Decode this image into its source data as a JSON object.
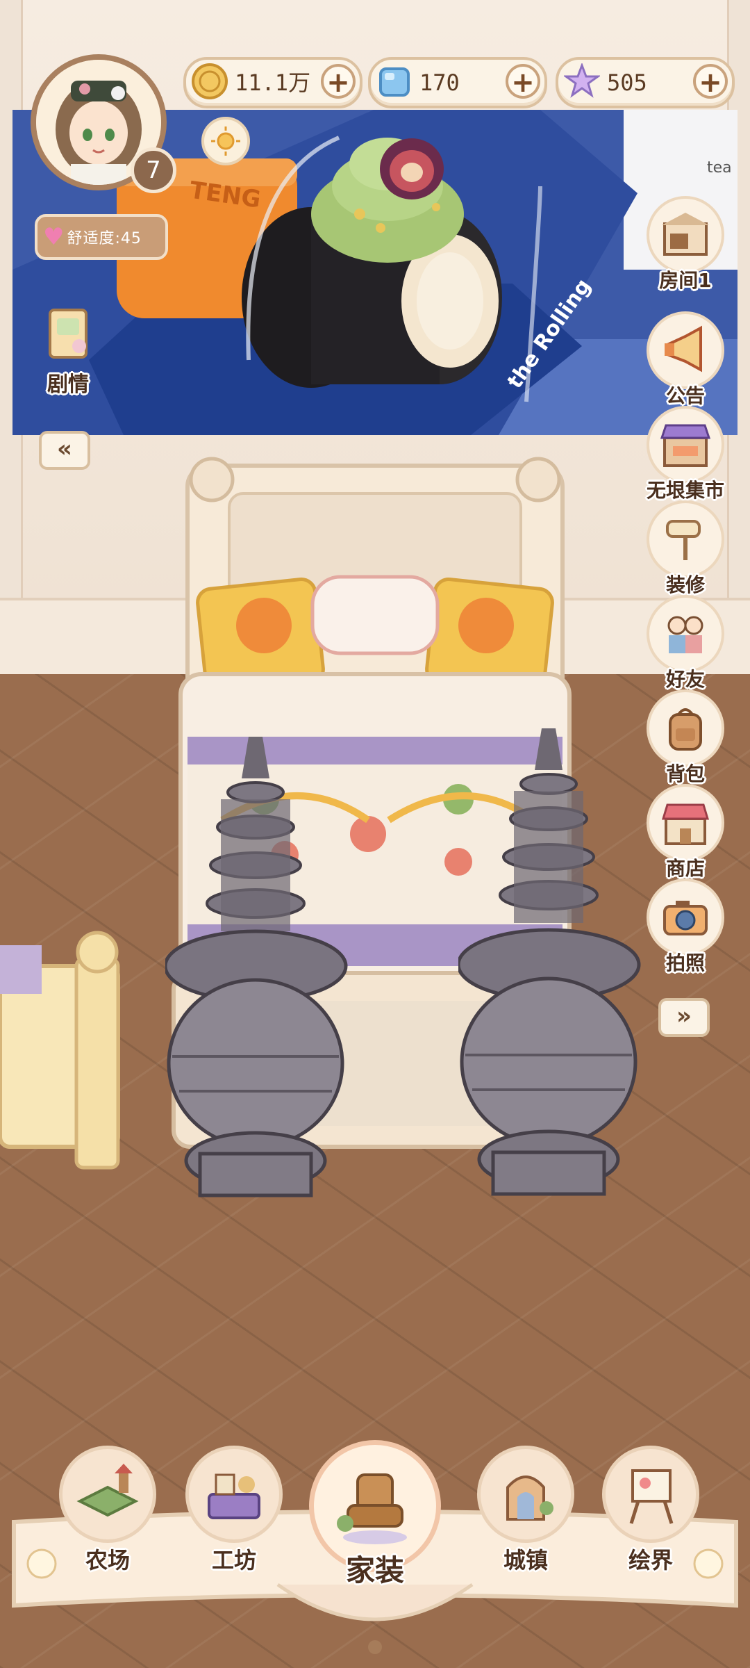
{
  "resources": {
    "coins": {
      "value": "11.1万",
      "icon": "coin-icon",
      "color": "#e9b44c"
    },
    "gems": {
      "value": "170",
      "icon": "ice-cube-icon",
      "color": "#7fb8e6"
    },
    "stars": {
      "value": "505",
      "icon": "star-icon",
      "color": "#c9a6ec"
    },
    "plus": "+"
  },
  "player": {
    "level": "7",
    "comfort_label": "舒适度:45",
    "avatar_icon": "character-portrait-icon"
  },
  "banner": {
    "box_text": "the Rolling",
    "side_text": "TENG",
    "corner_text": "tea"
  },
  "story": {
    "label": "剧情"
  },
  "collapse": {
    "left": "«",
    "right": "»"
  },
  "side_menu": [
    {
      "label": "房间1",
      "icon": "room-icon"
    },
    {
      "label": "公告",
      "icon": "megaphone-icon"
    },
    {
      "label": "无垠集市",
      "icon": "market-stall-icon"
    },
    {
      "label": "装修",
      "icon": "paint-roller-icon"
    },
    {
      "label": "好友",
      "icon": "friends-icon"
    },
    {
      "label": "背包",
      "icon": "backpack-icon"
    },
    {
      "label": "商店",
      "icon": "shop-icon"
    },
    {
      "label": "拍照",
      "icon": "camera-icon"
    }
  ],
  "bottom_nav": [
    {
      "label": "农场",
      "icon": "farm-icon"
    },
    {
      "label": "工坊",
      "icon": "workshop-icon"
    },
    {
      "label": "家装",
      "icon": "furniture-icon",
      "active": true
    },
    {
      "label": "城镇",
      "icon": "town-gate-icon"
    },
    {
      "label": "绘界",
      "icon": "easel-icon"
    }
  ]
}
